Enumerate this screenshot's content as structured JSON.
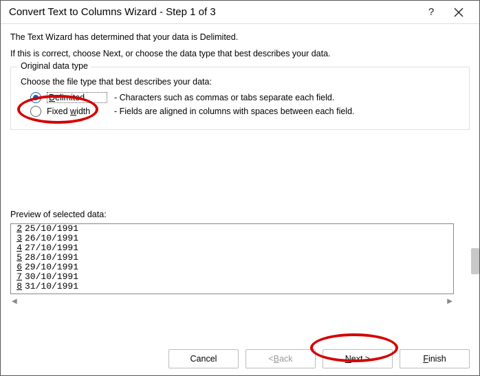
{
  "title": "Convert Text to Columns Wizard - Step 1 of 3",
  "intro_line1": "The Text Wizard has determined that your data is Delimited.",
  "intro_line2": "If this is correct, choose Next, or choose the data type that best describes your data.",
  "group": {
    "legend": "Original data type",
    "prompt": "Choose the file type that best describes your data:",
    "options": [
      {
        "id": "delimited",
        "label_pre": "D",
        "label_rest": "elimited",
        "desc": "- Characters such as commas or tabs separate each field.",
        "selected": true
      },
      {
        "id": "fixed",
        "label_pre": "Fixed ",
        "label_ul": "w",
        "label_post": "idth",
        "desc": "- Fields are aligned in columns with spaces between each field.",
        "selected": false
      }
    ]
  },
  "preview": {
    "label": "Preview of selected data:",
    "rows": [
      {
        "n": "2",
        "v": "25/10/1991"
      },
      {
        "n": "3",
        "v": "26/10/1991"
      },
      {
        "n": "4",
        "v": "27/10/1991"
      },
      {
        "n": "5",
        "v": "28/10/1991"
      },
      {
        "n": "6",
        "v": "29/10/1991"
      },
      {
        "n": "7",
        "v": "30/10/1991"
      },
      {
        "n": "8",
        "v": "31/10/1991"
      }
    ]
  },
  "buttons": {
    "cancel": "Cancel",
    "back_lt": "< ",
    "back_ul": "B",
    "back_rest": "ack",
    "next_ul": "N",
    "next_rest": "ext >",
    "finish_ul": "F",
    "finish_rest": "inish"
  }
}
